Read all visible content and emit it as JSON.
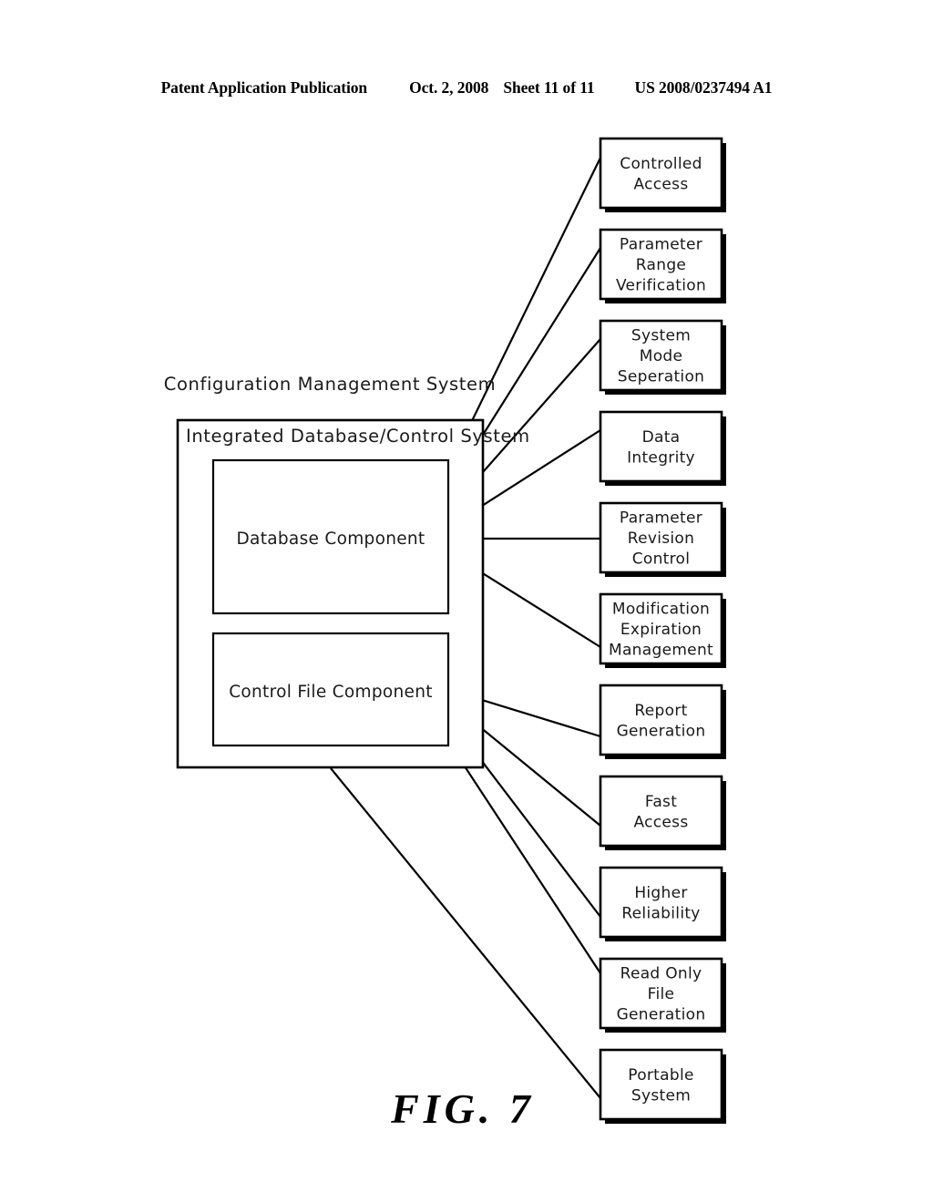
{
  "header": {
    "publication": "Patent Application Publication",
    "date": "Oct. 2, 2008",
    "sheet": "Sheet 11 of 11",
    "patent_number": "US 2008/0237494 A1"
  },
  "figure": {
    "caption": "FIG. 7",
    "system_label": "Configuration Management System",
    "subsystem_label": "Integrated Database/Control System",
    "components": [
      {
        "id": "database-component",
        "label": "Database Component"
      },
      {
        "id": "control-file-component",
        "label": "Control File Component"
      }
    ],
    "features": [
      {
        "id": "controlled-access",
        "lines": [
          "Controlled",
          "Access"
        ]
      },
      {
        "id": "parameter-range-verification",
        "lines": [
          "Parameter",
          "Range",
          "Verification"
        ]
      },
      {
        "id": "system-mode-seperation",
        "lines": [
          "System",
          "Mode",
          "Seperation"
        ]
      },
      {
        "id": "data-integrity",
        "lines": [
          "Data",
          "Integrity"
        ]
      },
      {
        "id": "parameter-revision-control",
        "lines": [
          "Parameter",
          "Revision",
          "Control"
        ]
      },
      {
        "id": "modification-expiration-management",
        "lines": [
          "Modification",
          "Expiration",
          "Management"
        ]
      },
      {
        "id": "report-generation",
        "lines": [
          "Report",
          "Generation"
        ]
      },
      {
        "id": "fast-access",
        "lines": [
          "Fast",
          "Access"
        ]
      },
      {
        "id": "higher-reliability",
        "lines": [
          "Higher",
          "Reliability"
        ]
      },
      {
        "id": "read-only-file-generation",
        "lines": [
          "Read Only",
          "File",
          "Generation"
        ]
      },
      {
        "id": "portable-system",
        "lines": [
          "Portable",
          "System"
        ]
      }
    ],
    "colors": {
      "ink": "#000000",
      "paper": "#ffffff"
    }
  }
}
